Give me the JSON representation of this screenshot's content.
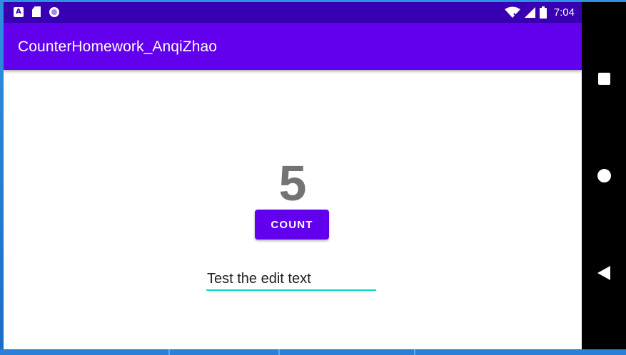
{
  "status_bar": {
    "time": "7:04",
    "left_icons": [
      "notification-a-icon",
      "sd-card-icon",
      "sync-circle-icon"
    ],
    "right_icons": [
      "wifi-icon",
      "cell-signal-icon",
      "battery-icon"
    ]
  },
  "app_bar": {
    "title": "CounterHomework_AnqiZhao"
  },
  "main": {
    "count_value": "5",
    "count_button_label": "COUNT",
    "edit_text_value": "Test the edit text"
  },
  "nav_bar": {
    "buttons": [
      "recents-square-icon",
      "home-circle-icon",
      "back-triangle-icon"
    ]
  },
  "colors": {
    "status_bar": "#3700b3",
    "app_bar": "#6200ee",
    "accent": "#03dac5",
    "count_text": "#737373"
  }
}
